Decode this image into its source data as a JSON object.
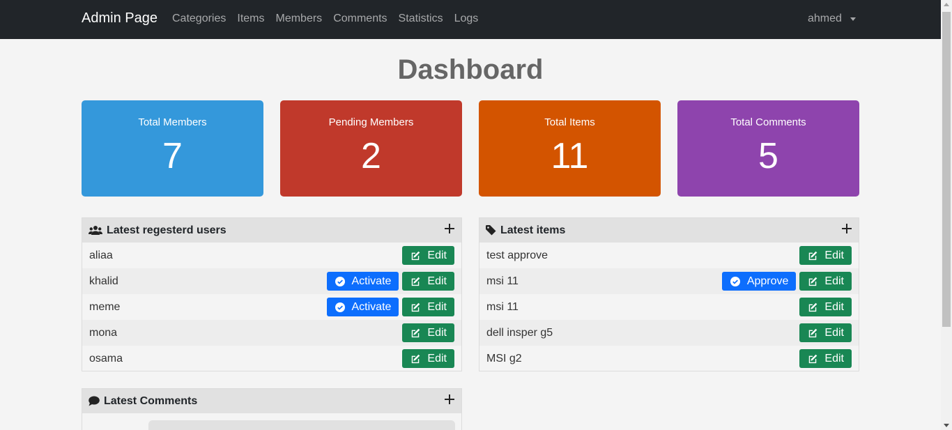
{
  "navbar": {
    "brand": "Admin Page",
    "links": [
      "Categories",
      "Items",
      "Members",
      "Comments",
      "Statistics",
      "Logs"
    ],
    "user": "ahmed"
  },
  "page_title": "Dashboard",
  "stats": [
    {
      "label": "Total Members",
      "value": "7",
      "color": "#3498db"
    },
    {
      "label": "Pending Members",
      "value": "2",
      "color": "#c0392b"
    },
    {
      "label": "Total Items",
      "value": "11",
      "color": "#d35400"
    },
    {
      "label": "Total Comments",
      "value": "5",
      "color": "#8e44ad"
    }
  ],
  "users_panel": {
    "title": "Latest regesterd users",
    "edit_label": "Edit",
    "activate_label": "Activate",
    "rows": [
      {
        "name": "aliaa",
        "activate": false
      },
      {
        "name": "khalid",
        "activate": true
      },
      {
        "name": "meme",
        "activate": true
      },
      {
        "name": "mona",
        "activate": false
      },
      {
        "name": "osama",
        "activate": false
      }
    ]
  },
  "items_panel": {
    "title": "Latest items",
    "edit_label": "Edit",
    "approve_label": "Approve",
    "rows": [
      {
        "name": "test approve",
        "approve": false
      },
      {
        "name": "msi 11",
        "approve": true
      },
      {
        "name": "msi 11",
        "approve": false
      },
      {
        "name": "dell insper g5",
        "approve": false
      },
      {
        "name": "MSI g2",
        "approve": false
      }
    ]
  },
  "comments_panel": {
    "title": "Latest Comments"
  }
}
